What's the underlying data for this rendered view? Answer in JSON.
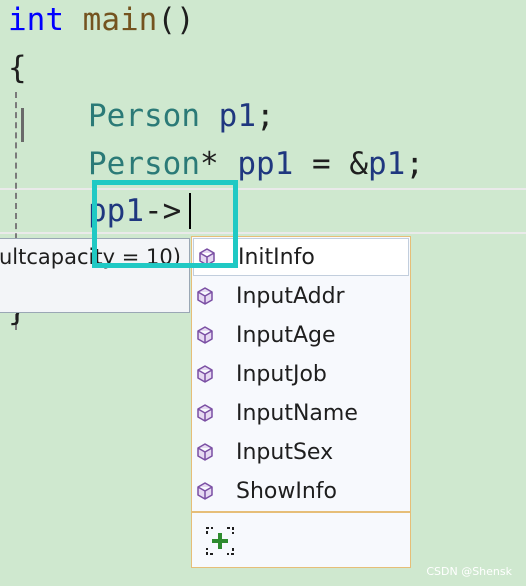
{
  "editor": {
    "line1": {
      "kw": "int",
      "fn": "main",
      "punct": "()"
    },
    "line2": {
      "brace": "{"
    },
    "line3": {
      "type": "Person",
      "var": "p1",
      "punct": ";"
    },
    "line4": {
      "type": "Person",
      "ptr": "*",
      "var": "pp1",
      "eq": "=",
      "amp": "&",
      "ref": "p1",
      "punct": ";"
    },
    "line5": {
      "var": "pp1",
      "arrow": "->"
    },
    "closing": {
      "brace": "}"
    }
  },
  "tooltip": {
    "text": "ultcapacity = 10)"
  },
  "completion": {
    "items": [
      {
        "label": "InitInfo",
        "icon": "member-icon",
        "selected": true
      },
      {
        "label": "InputAddr",
        "icon": "member-icon"
      },
      {
        "label": "InputAge",
        "icon": "member-icon"
      },
      {
        "label": "InputJob",
        "icon": "member-icon"
      },
      {
        "label": "InputName",
        "icon": "member-icon"
      },
      {
        "label": "InputSex",
        "icon": "member-icon"
      },
      {
        "label": "ShowInfo",
        "icon": "member-icon"
      }
    ],
    "filter_icon": "add-filter-icon"
  },
  "colors": {
    "accent_box": "#20c9c4",
    "popup_border": "#e6be78",
    "background": "#cfe8cf"
  },
  "watermark": "CSDN @Shensk"
}
